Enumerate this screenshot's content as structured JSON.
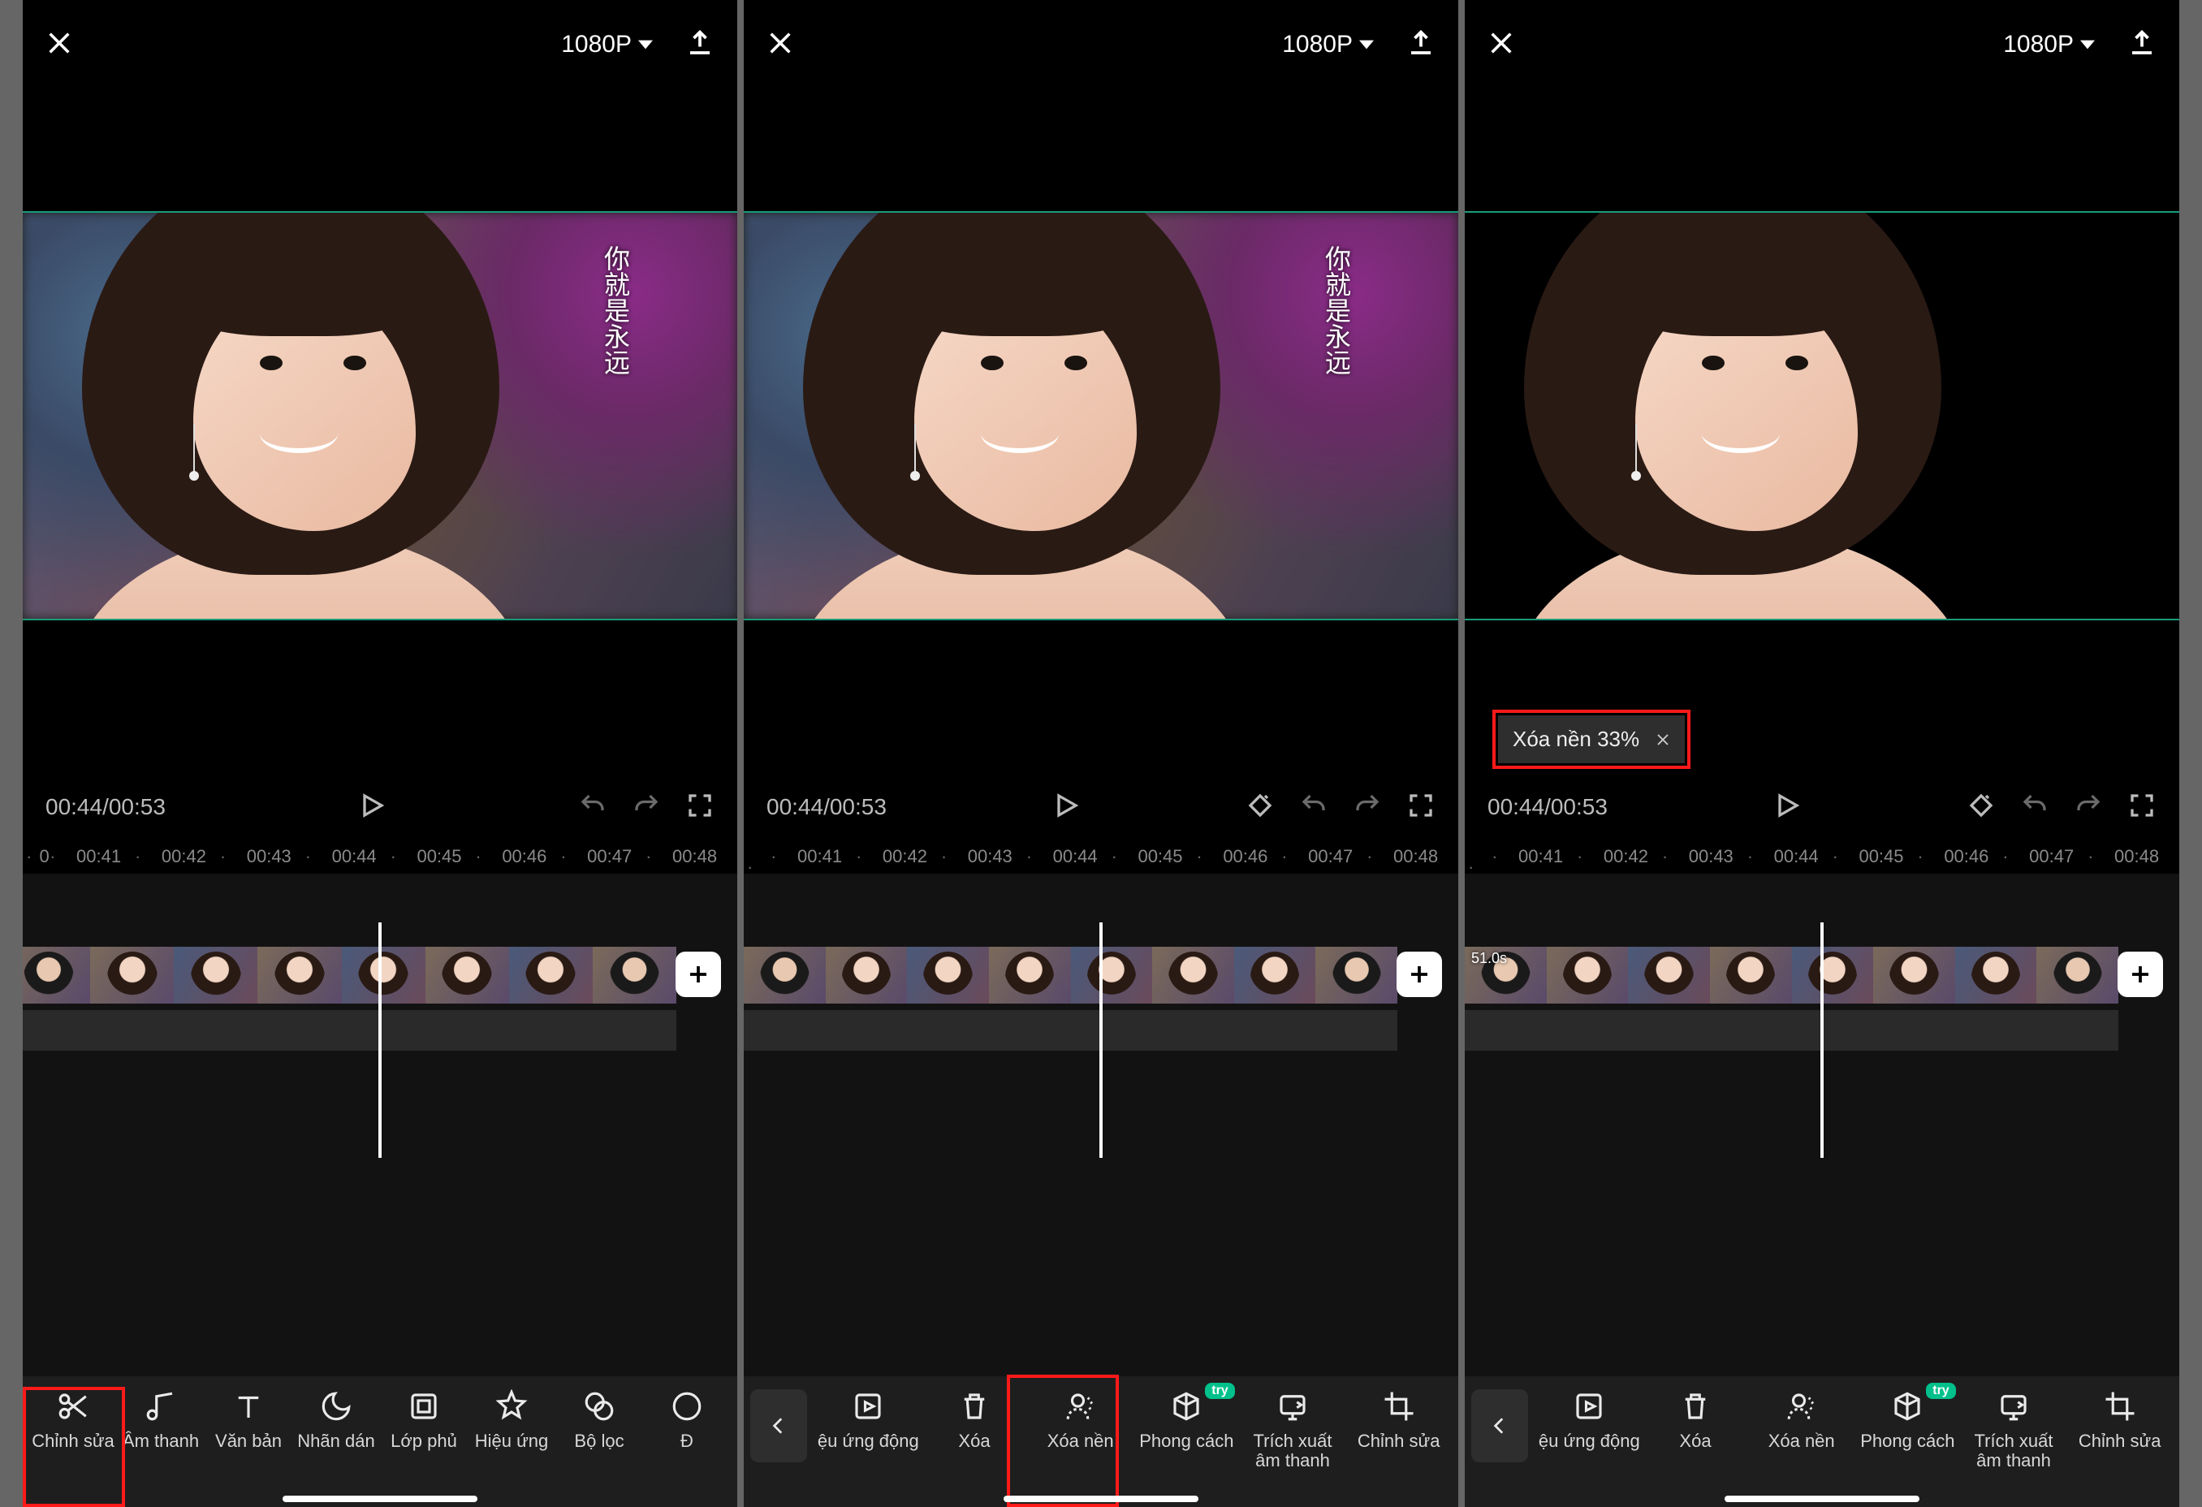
{
  "header": {
    "resolution": "1080P"
  },
  "preview": {
    "overlay_text": "你就是永远",
    "timecode": "00:44/00:53"
  },
  "ruler_marks": [
    "00:41",
    "00:42",
    "00:43",
    "00:44",
    "00:45",
    "00:46",
    "00:47",
    "00:48"
  ],
  "toast": {
    "text": "Xóa nền 33%"
  },
  "clip": {
    "duration_label": "51.0s"
  },
  "toolbar_main": [
    {
      "key": "edit",
      "label": "Chỉnh sửa"
    },
    {
      "key": "audio",
      "label": "Âm thanh"
    },
    {
      "key": "text",
      "label": "Văn bản"
    },
    {
      "key": "sticker",
      "label": "Nhãn dán"
    },
    {
      "key": "overlay",
      "label": "Lớp phủ"
    },
    {
      "key": "effect",
      "label": "Hiệu ứng"
    },
    {
      "key": "filter",
      "label": "Bộ lọc"
    },
    {
      "key": "adjust_partial",
      "label": "Đ"
    }
  ],
  "toolbar_sub": [
    {
      "key": "anim",
      "label": "ệu ứng động"
    },
    {
      "key": "delete",
      "label": "Xóa"
    },
    {
      "key": "removebg",
      "label": "Xóa nền"
    },
    {
      "key": "style",
      "label": "Phong cách",
      "try": "try"
    },
    {
      "key": "extract_audio",
      "label": "Trích xuất âm thanh"
    },
    {
      "key": "edit",
      "label": "Chỉnh sửa"
    }
  ]
}
